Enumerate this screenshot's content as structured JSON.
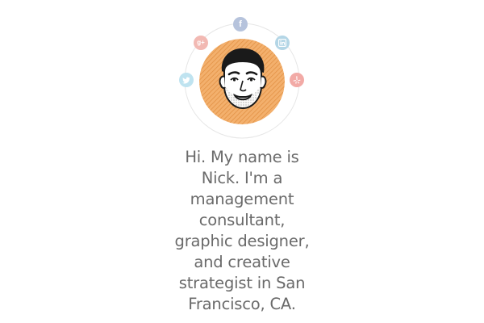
{
  "avatar": {
    "alt": "Nick"
  },
  "social": {
    "facebook": {
      "icon": "facebook-icon",
      "glyph": "f",
      "color": "#b6c3dc"
    },
    "google_plus": {
      "icon": "google-plus-icon",
      "glyph": "g+",
      "color": "#f2b9b3"
    },
    "linkedin": {
      "icon": "linkedin-icon",
      "color": "#b4d6e6"
    },
    "twitter": {
      "icon": "twitter-icon",
      "color": "#bfe3f0"
    },
    "yelp": {
      "icon": "yelp-icon",
      "color": "#f2aaa6"
    }
  },
  "bio": {
    "lines": [
      "Hi. My name is",
      "Nick. I'm a",
      "management",
      "consultant,",
      "graphic designer,",
      "and creative",
      "strategist in San",
      "Francisco, CA."
    ]
  },
  "colors": {
    "avatar_bg": "#f1a75e",
    "text": "#6a6a6a",
    "orbit": "#e6e6e6"
  }
}
